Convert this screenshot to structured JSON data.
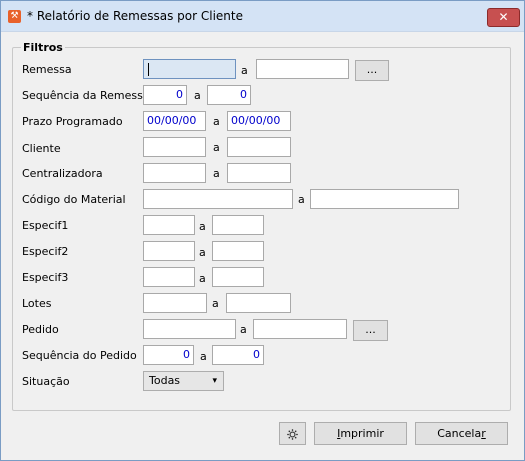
{
  "window": {
    "title": "* Relatório de Remessas por Cliente",
    "app_icon": "app-logo-icon",
    "close_label": "✕"
  },
  "group": {
    "title": "Filtros"
  },
  "sep_label": "a",
  "browse_label": "...",
  "fields": {
    "remessa": {
      "label": "Remessa",
      "from": "",
      "to": ""
    },
    "sequencia_remessa": {
      "label": "Sequência da Remessa",
      "from": "0",
      "to": "0"
    },
    "prazo_programado": {
      "label": "Prazo Programado",
      "from": "00/00/00",
      "to": "00/00/00"
    },
    "cliente": {
      "label": "Cliente",
      "from": "",
      "to": ""
    },
    "centralizadora": {
      "label": "Centralizadora",
      "from": "",
      "to": ""
    },
    "codigo_material": {
      "label": "Código do Material",
      "from": "",
      "to": ""
    },
    "especif1": {
      "label": "Especif1",
      "from": "",
      "to": ""
    },
    "especif2": {
      "label": "Especif2",
      "from": "",
      "to": ""
    },
    "especif3": {
      "label": "Especif3",
      "from": "",
      "to": ""
    },
    "lotes": {
      "label": "Lotes",
      "from": "",
      "to": ""
    },
    "pedido": {
      "label": "Pedido",
      "from": "",
      "to": ""
    },
    "sequencia_pedido": {
      "label": "Sequência do Pedido",
      "from": "0",
      "to": "0"
    },
    "situacao": {
      "label": "Situação",
      "value": "Todas"
    }
  },
  "buttons": {
    "settings_icon": "gear-icon",
    "imprimir_first": "I",
    "imprimir_rest": "mprimir",
    "cancelar_first": "Cancela",
    "cancelar_u": "r"
  }
}
